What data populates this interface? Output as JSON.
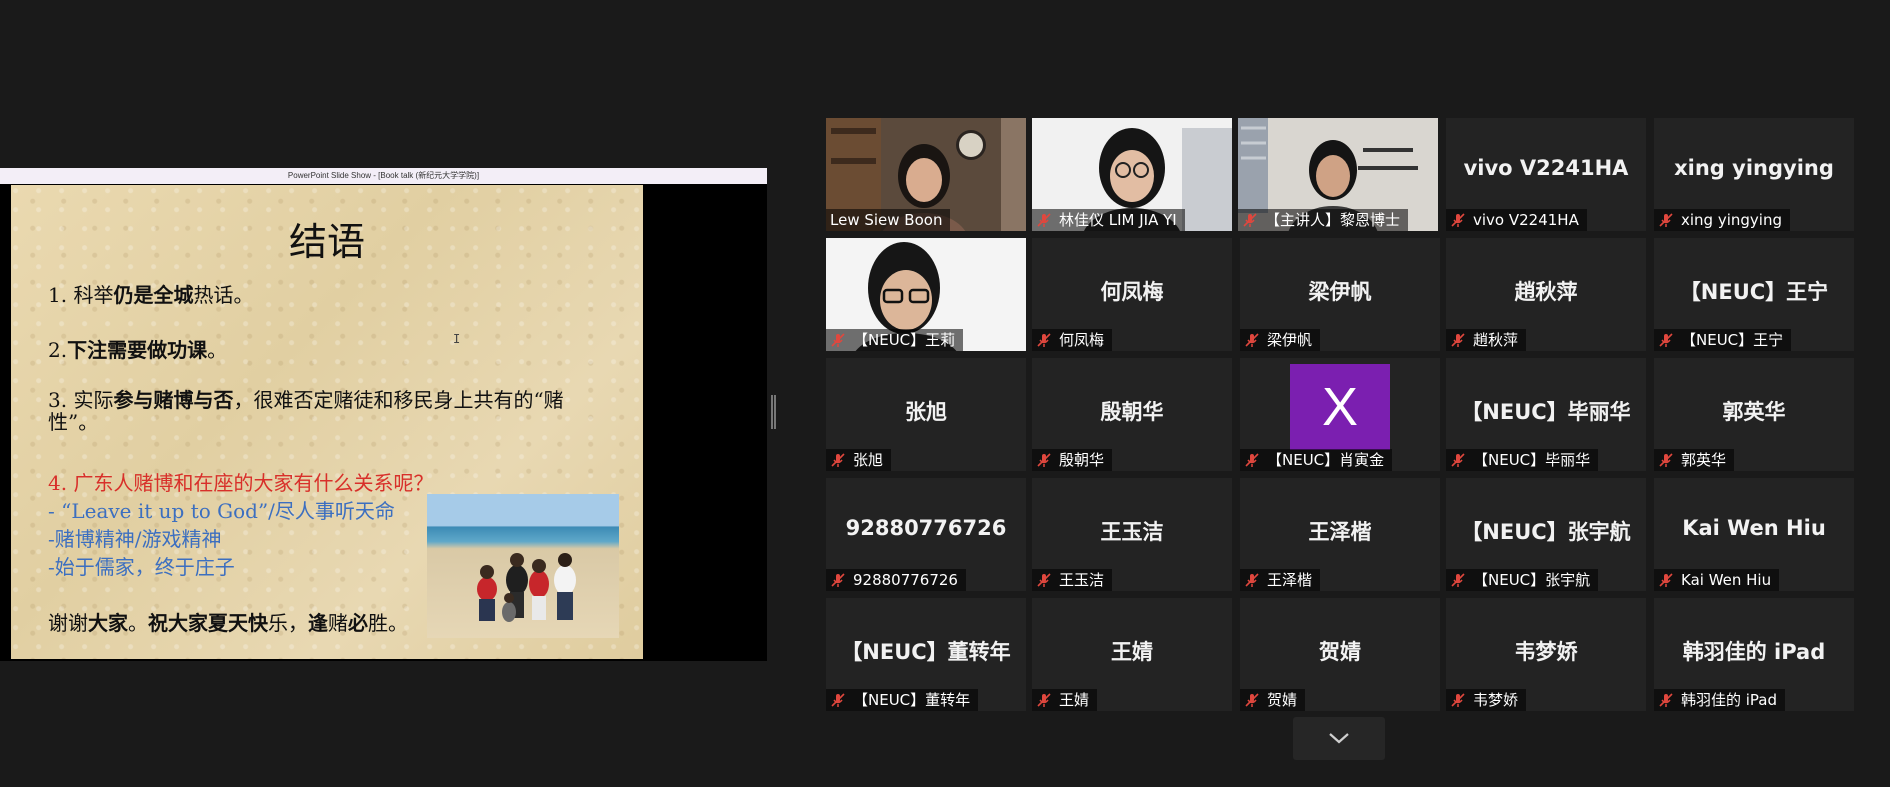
{
  "share": {
    "window_title": "PowerPoint Slide Show - [Book talk (新纪元大学学院)]",
    "slide": {
      "title": "结语",
      "p1_a": "1. 科举",
      "p1_b": "仍是全城",
      "p1_c": "热话。",
      "p2_a": "2.",
      "p2_b": "下注需要做功课",
      "p2_c": "。",
      "p3_a": "3. 实际",
      "p3_b": "参与赌博与否",
      "p3_c": "，很难否定赌徒和移民身上共有的“赌性”。",
      "p4": "4. 广东人赌博和在座的大家有什么关系呢？",
      "p5": "- “Leave it up to God”/尽人事听天命",
      "p6": "-赌博精神/游戏精神",
      "p7": "-始于儒家，终于庄子",
      "p8_a": "谢谢",
      "p8_b": "大家",
      "p8_c": "。",
      "p8_d": "祝大家夏天快",
      "p8_e": "乐，",
      "p8_f": "逢",
      "p8_g": "赌",
      "p8_h": "必",
      "p8_i": "胜。",
      "cursor": "I"
    }
  },
  "participants": [
    {
      "label": "Lew Siew Boon",
      "big": "",
      "muted": false,
      "video": true
    },
    {
      "label": "林佳仪 LIM JIA YI",
      "big": "",
      "muted": true,
      "video": true
    },
    {
      "label": "【主讲人】黎恩博士",
      "big": "",
      "muted": true,
      "video": true,
      "active": true
    },
    {
      "label": "vivo V2241HA",
      "big": "vivo V2241HA",
      "muted": true
    },
    {
      "label": "xing yingying",
      "big": "xing yingying",
      "muted": true
    },
    {
      "label": "【NEUC】王莉",
      "big": "",
      "muted": true,
      "video": true
    },
    {
      "label": "何凤梅",
      "big": "何凤梅",
      "muted": true
    },
    {
      "label": "梁伊帆",
      "big": "梁伊帆",
      "muted": true
    },
    {
      "label": "趙秋萍",
      "big": "趙秋萍",
      "muted": true
    },
    {
      "label": "【NEUC】王宁",
      "big": "【NEUC】王宁",
      "muted": true
    },
    {
      "label": "张旭",
      "big": "张旭",
      "muted": true
    },
    {
      "label": "殷朝华",
      "big": "殷朝华",
      "muted": true
    },
    {
      "label": "【NEUC】肖寅金",
      "big": "",
      "muted": true,
      "avatar": "X"
    },
    {
      "label": "【NEUC】毕丽华",
      "big": "【NEUC】毕丽华",
      "muted": true
    },
    {
      "label": "郭英华",
      "big": "郭英华",
      "muted": true
    },
    {
      "label": "92880776726",
      "big": "92880776726",
      "muted": true
    },
    {
      "label": "王玉洁",
      "big": "王玉洁",
      "muted": true
    },
    {
      "label": "王泽楷",
      "big": "王泽楷",
      "muted": true
    },
    {
      "label": "【NEUC】张宇航",
      "big": "【NEUC】张宇航",
      "muted": true
    },
    {
      "label": "Kai Wen Hiu",
      "big": "Kai Wen Hiu",
      "muted": true
    },
    {
      "label": "【NEUC】董转年",
      "big": "【NEUC】董转年",
      "muted": true
    },
    {
      "label": "王婧",
      "big": "王婧",
      "muted": true
    },
    {
      "label": "贺婧",
      "big": "贺婧",
      "muted": true
    },
    {
      "label": "韦梦娇",
      "big": "韦梦娇",
      "muted": true
    },
    {
      "label": "韩羽佳的 iPad",
      "big": "韩羽佳的 iPad",
      "muted": true
    }
  ],
  "icons": {
    "mic_muted": "mic-muted-icon",
    "expand": "chevron-down-icon"
  },
  "colors": {
    "active_speaker": "#c8e65a",
    "mute_red": "#e0473e",
    "avatar_purple": "#7b1fb0"
  }
}
